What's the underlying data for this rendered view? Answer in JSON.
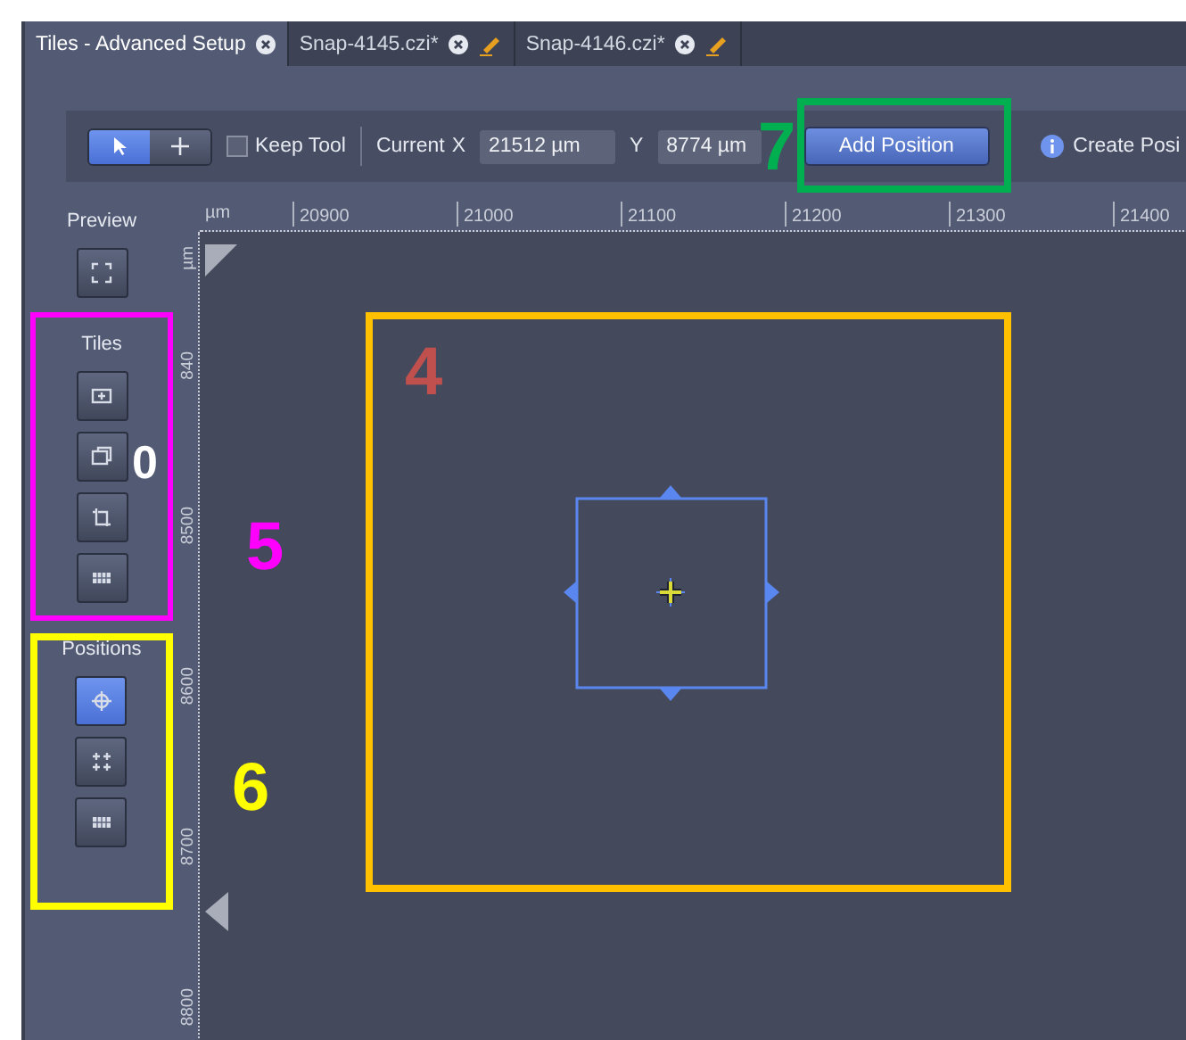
{
  "tabs": [
    {
      "label": "Tiles - Advanced Setup",
      "selected": true,
      "modified": false
    },
    {
      "label": "Snap-4145.czi*",
      "selected": false,
      "modified": true
    },
    {
      "label": "Snap-4146.czi*",
      "selected": false,
      "modified": true
    }
  ],
  "toolbar": {
    "tools": [
      {
        "kind": "pointer",
        "selected": true
      },
      {
        "kind": "crosshair",
        "selected": false
      }
    ],
    "keep_tool": {
      "label": "Keep Tool",
      "checked": false
    },
    "current_label": "Current",
    "x_label": "X",
    "x_value": "21512 µm",
    "y_label": "Y",
    "y_value": "8774 µm",
    "add_button": "Add Position",
    "info_text": "Create Posi"
  },
  "sidebar": [
    {
      "title": "Preview",
      "buttons": [
        {
          "kind": "preview",
          "selected": false
        }
      ]
    },
    {
      "title": "Tiles",
      "buttons": [
        {
          "kind": "add-tile",
          "selected": false
        },
        {
          "kind": "tile-region",
          "selected": false
        },
        {
          "kind": "crop-region",
          "selected": false
        },
        {
          "kind": "grid",
          "selected": false
        }
      ]
    },
    {
      "title": "Positions",
      "buttons": [
        {
          "kind": "target",
          "selected": true
        },
        {
          "kind": "multi-point",
          "selected": false
        },
        {
          "kind": "grid",
          "selected": false
        }
      ]
    }
  ],
  "ruler": {
    "x_unit": "µm",
    "x_labels": [
      "20900",
      "21000",
      "21100",
      "21200",
      "21300",
      "21400"
    ],
    "y_unit": "µm",
    "y_labels": [
      "840",
      "8500",
      "8600",
      "8700",
      "8800"
    ]
  },
  "annotation_frames": [
    {
      "color": "#00b050"
    },
    {
      "color": "#ffc000"
    },
    {
      "color": "#ff00ff"
    },
    {
      "color": "#ffff00"
    }
  ],
  "annotation_labels": [
    {
      "text": "7",
      "color": "#00b050"
    },
    {
      "text": "4",
      "color": "#c0504d"
    },
    {
      "text": "0",
      "color": "#ffffff"
    },
    {
      "text": "5",
      "color": "#ff00ff"
    },
    {
      "text": "6",
      "color": "#ffff00"
    }
  ]
}
